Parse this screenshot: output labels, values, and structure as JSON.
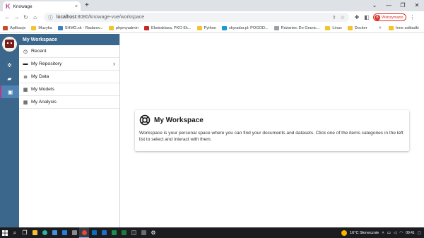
{
  "browser": {
    "tab_title": "Knowage",
    "tab_close": "×",
    "new_tab": "+",
    "window_controls": [
      "⌄",
      "—",
      "❐",
      "✕"
    ],
    "url_host": "localhost",
    "url_path": ":8080/knowage-vue/workspace",
    "profile_label": "Wstrzymano",
    "profile_initial": "B"
  },
  "bookmarks": [
    {
      "label": "Aplikacje",
      "icon": "apps-grid-icon",
      "color": "grid"
    },
    {
      "label": "Muzyka",
      "icon": "folder-icon",
      "color": "folder"
    },
    {
      "label": "SHMG.sk - Radarov...",
      "icon": "radar-icon",
      "color": "blue"
    },
    {
      "label": "phpmyadmin",
      "icon": "folder-icon",
      "color": "folder"
    },
    {
      "label": "Ekstraklasa, PKO Ek...",
      "icon": "ekstraklasa-icon",
      "color": "red"
    },
    {
      "label": "Python",
      "icon": "folder-icon",
      "color": "folder"
    },
    {
      "label": "skyradar.pl: POGOD...",
      "icon": "skyradar-icon",
      "color": "cyan"
    },
    {
      "label": "Różaniec Do Granic...",
      "icon": "page-icon",
      "color": "gray"
    },
    {
      "label": "Linux",
      "icon": "folder-icon",
      "color": "folder"
    },
    {
      "label": "Docker",
      "icon": "folder-icon",
      "color": "folder"
    }
  ],
  "bookmarks_more": "»",
  "bookmarks_other": "Inne zakładki",
  "sidebar": {
    "header": "My Workspace",
    "items": [
      {
        "label": "Recent",
        "icon": "clock-icon",
        "glyph": "◷"
      },
      {
        "label": "My Repository",
        "icon": "folder-icon",
        "glyph": "▬"
      },
      {
        "label": "My Data",
        "icon": "database-icon",
        "glyph": "≣"
      },
      {
        "label": "My Models",
        "icon": "table-icon",
        "glyph": "▦"
      },
      {
        "label": "My Analysis",
        "icon": "grid-icon",
        "glyph": "▦"
      }
    ],
    "repository_chevron": "›"
  },
  "main": {
    "card_title": "My Workspace",
    "card_description": "Workspace is your personal space where you can find your documents and datasets. Click one of the items categories in the left list to select and interact with them."
  },
  "taskbar": {
    "weather": "16°C  Słonecznie",
    "time": "09:41",
    "date": "..."
  },
  "colors": {
    "primary": "#3b678c",
    "accent": "#b8398c"
  }
}
